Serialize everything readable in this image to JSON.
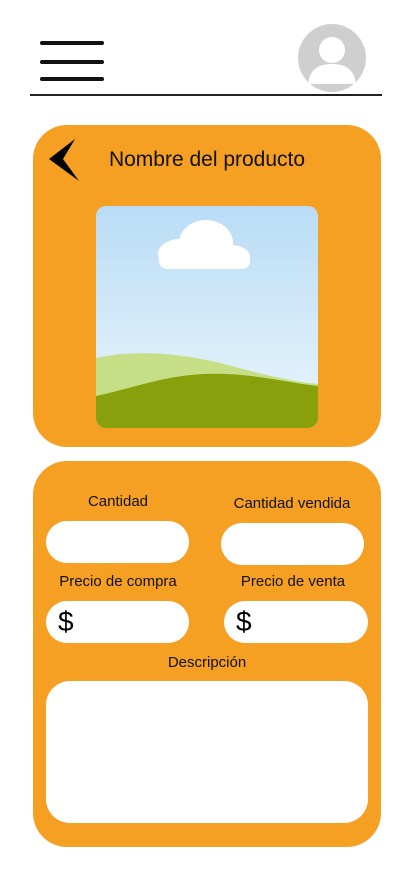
{
  "header": {
    "menu_icon": "hamburger-menu-icon",
    "avatar_icon": "user-avatar-icon"
  },
  "product": {
    "back_icon": "chevron-left-icon",
    "title": "Nombre del producto",
    "image_icon": "image-placeholder-icon"
  },
  "form": {
    "quantity": {
      "label": "Cantidad",
      "value": ""
    },
    "quantity_sold": {
      "label": "Cantidad vendida",
      "value": ""
    },
    "purchase_price": {
      "label": "Precio de compra",
      "prefix": "$",
      "value": ""
    },
    "sale_price": {
      "label": "Precio de venta",
      "prefix": "$",
      "value": ""
    },
    "description": {
      "label": "Descripción",
      "value": ""
    }
  },
  "colors": {
    "card_orange": "#f5a023",
    "field_white": "#ffffff"
  }
}
